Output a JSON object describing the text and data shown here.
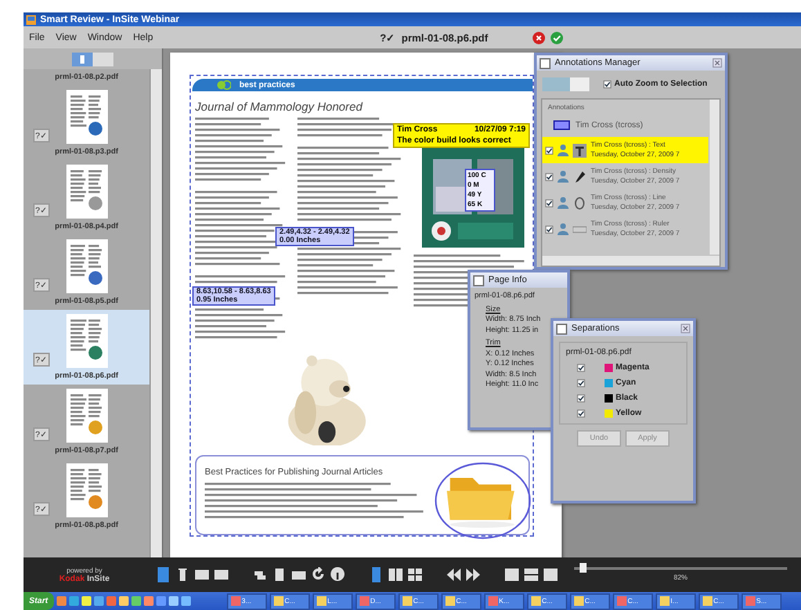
{
  "window": {
    "title": "Smart Review - InSite Webinar"
  },
  "menu": [
    "File",
    "View",
    "Window",
    "Help"
  ],
  "document_bar": {
    "status": "?✓",
    "filename": "prml-01-08.p6.pdf"
  },
  "sidebar": {
    "top_label": "prml-01-08.p2.pdf",
    "thumbnails": [
      {
        "label": "prml-01-08.p3.pdf",
        "status": "?✓",
        "selected": false
      },
      {
        "label": "prml-01-08.p4.pdf",
        "status": "?✓",
        "selected": false
      },
      {
        "label": "prml-01-08.p5.pdf",
        "status": "?✓",
        "selected": false
      },
      {
        "label": "prml-01-08.p6.pdf",
        "status": "?✓",
        "selected": true
      },
      {
        "label": "prml-01-08.p7.pdf",
        "status": "?✓",
        "selected": false
      },
      {
        "label": "prml-01-08.p8.pdf",
        "status": "?✓",
        "selected": false
      }
    ]
  },
  "page": {
    "header": "best practices",
    "title": "Journal of Mammology Honored",
    "box_heading": "Best Practices for Publishing Journal Articles",
    "note": {
      "author": "Tim Cross",
      "time": "10/27/09 7:19",
      "text": "The color build looks correct"
    },
    "color_readout": [
      "100 C",
      "0 M",
      "49 Y",
      "65 K"
    ],
    "measurements": [
      {
        "coords": "2.49,4.32 - 2.49,4.32",
        "distance": "0.00 Inches"
      },
      {
        "coords": "8.63,10.58 - 8.63,8.63",
        "distance": "0.95 Inches"
      }
    ]
  },
  "annotations_manager": {
    "title": "Annotations Manager",
    "auto_zoom": {
      "label": "Auto Zoom to Selection",
      "checked": true
    },
    "group": "Annotations",
    "user": "Tim Cross (tcross)",
    "items": [
      {
        "kind": "text",
        "title": "Tim Cross (tcross) : Text",
        "date": "Tuesday, October 27, 2009 7",
        "checked": true,
        "selected": true
      },
      {
        "kind": "density",
        "title": "Tim Cross (tcross) : Density",
        "date": "Tuesday, October 27, 2009 7",
        "checked": true,
        "selected": false
      },
      {
        "kind": "line",
        "title": "Tim Cross (tcross) : Line",
        "date": "Tuesday, October 27, 2009 7",
        "checked": true,
        "selected": false
      },
      {
        "kind": "ruler",
        "title": "Tim Cross (tcross) : Ruler",
        "date": "Tuesday, October 27, 2009 7",
        "checked": true,
        "selected": false
      }
    ]
  },
  "page_info": {
    "title": "Page Info",
    "filename": "prml-01-08.p6.pdf",
    "size_label": "Size",
    "size": [
      "Width: 8.75 Inch",
      "Height: 11.25 in"
    ],
    "trim_label": "Trim",
    "trim": [
      "X: 0.12 Inches",
      "Y: 0.12 Inches",
      "Width: 8.5 Inch",
      "Height: 11.0 Inc"
    ]
  },
  "separations": {
    "title": "Separations",
    "filename": "prml-01-08.p6.pdf",
    "plates": [
      {
        "name": "Magenta",
        "color": "#e0157a",
        "checked": true
      },
      {
        "name": "Cyan",
        "color": "#1aa3d9",
        "checked": true
      },
      {
        "name": "Black",
        "color": "#000000",
        "checked": true
      },
      {
        "name": "Yellow",
        "color": "#f2ea00",
        "checked": true
      }
    ],
    "buttons": [
      "Undo",
      "Apply"
    ]
  },
  "toolbar": {
    "powered_by": "powered by",
    "brand": "Kodak",
    "product": "InSite",
    "zoom": {
      "level": 0.04,
      "reading": "82%"
    }
  },
  "taskbar": {
    "start": "Start",
    "items": [
      "3...",
      "C...",
      "L...",
      "D...",
      "C...",
      "C...",
      "K...",
      "C...",
      "C...",
      "C...",
      "I...",
      "C...",
      "S..."
    ]
  }
}
